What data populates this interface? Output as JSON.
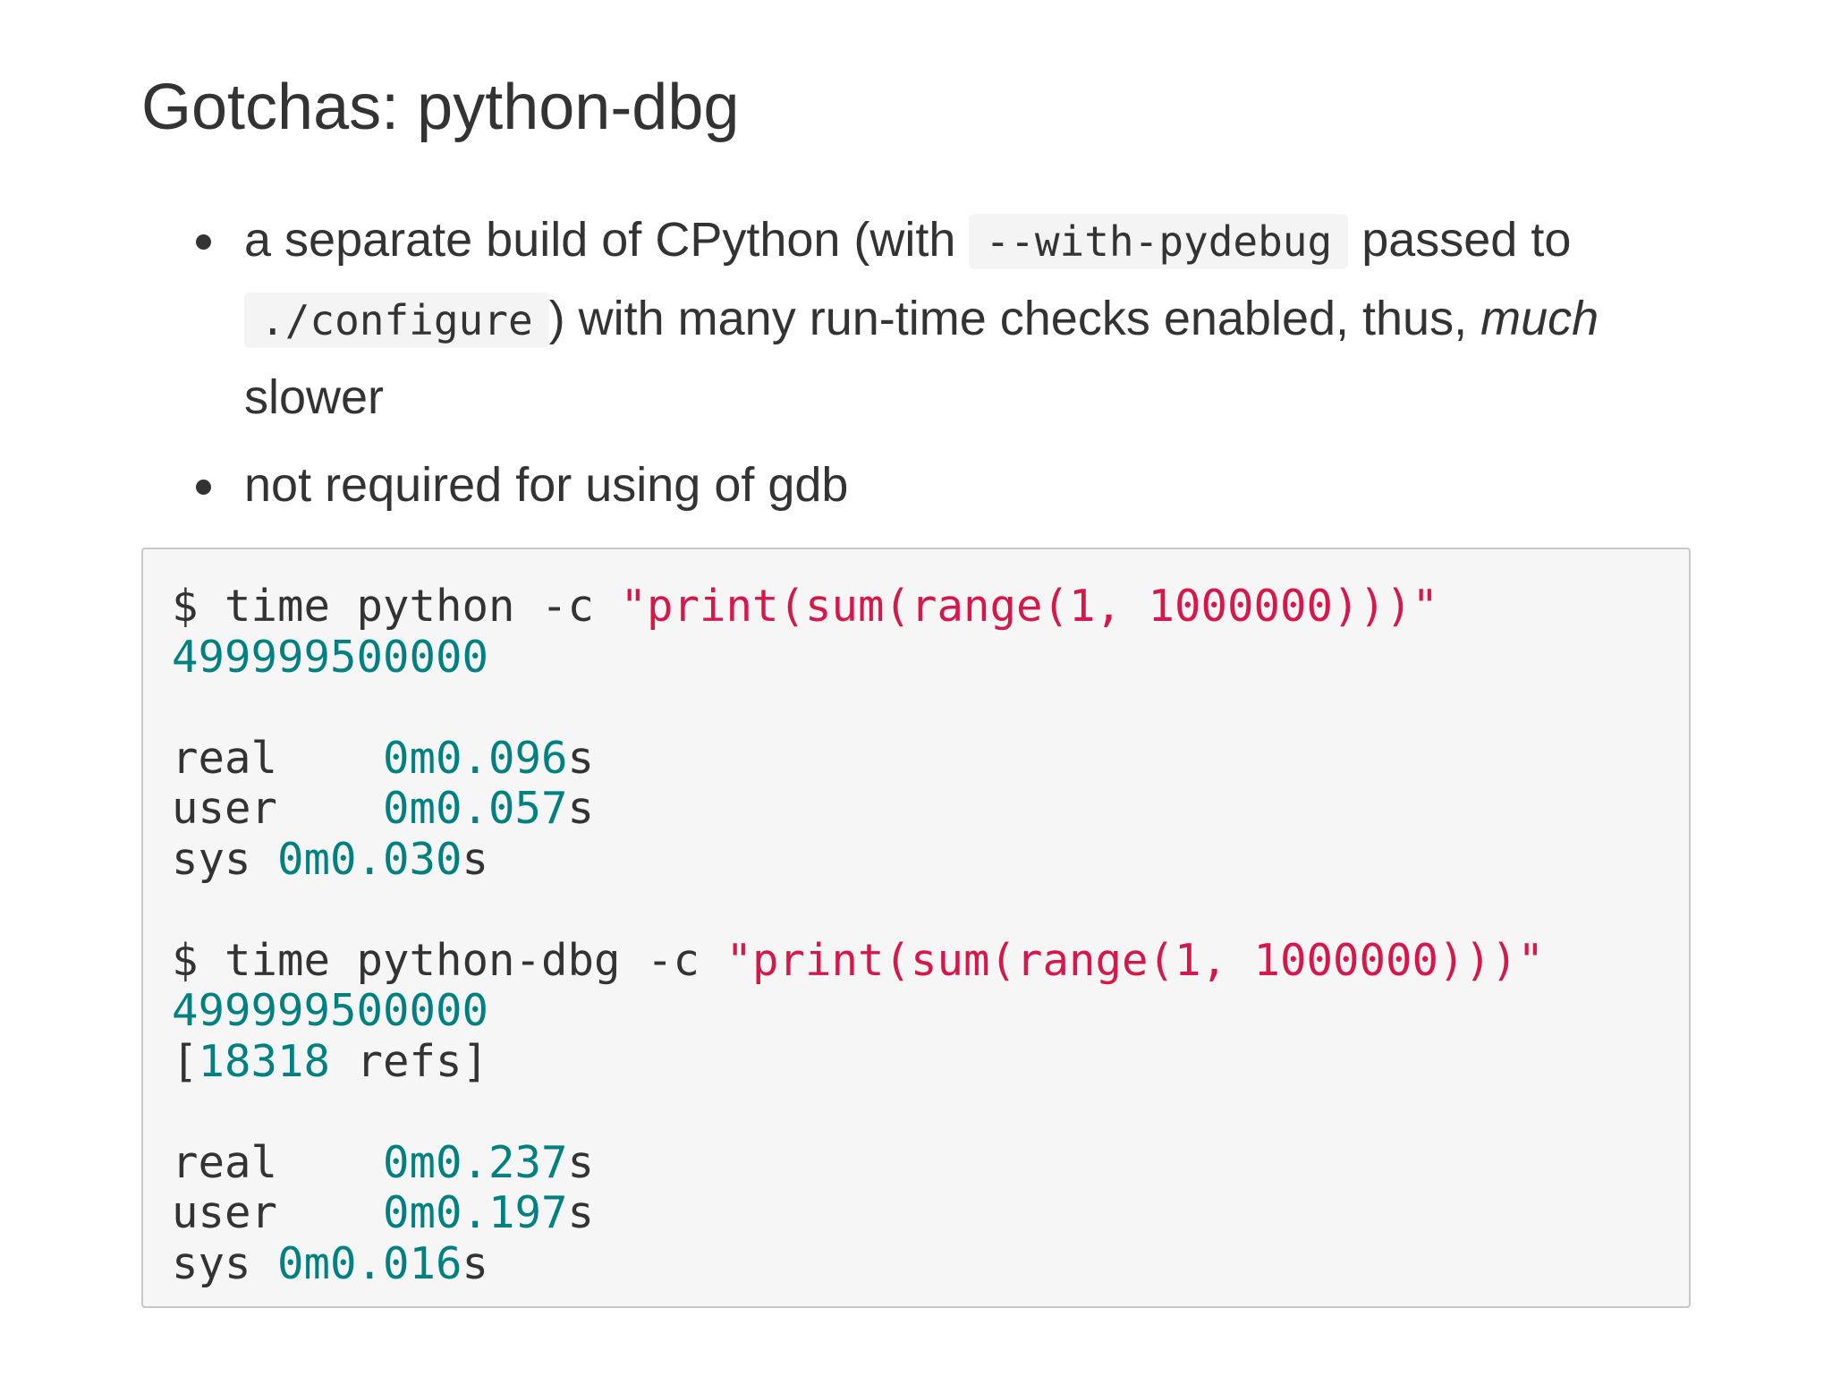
{
  "title": "Gotchas: python-dbg",
  "bullets": {
    "b1": {
      "t1": "a separate build of CPython (with ",
      "code1": "--with-pydebug",
      "t2": " passed to ",
      "code2": "./configure",
      "t3": ") with many run-time checks enabled, thus, ",
      "em": "much",
      "t4": " slower"
    },
    "b2": "not required for using of gdb"
  },
  "code": {
    "run1": {
      "prompt": "$ time python -c ",
      "arg": "\"print(sum(range(1, 1000000)))\"",
      "output": "499999500000",
      "real_label": "real    ",
      "real_val": "0m0.096",
      "user_label": "user    ",
      "user_val": "0m0.057",
      "sys_label": "sys ",
      "sys_val": "0m0.030",
      "unit": "s"
    },
    "run2": {
      "prompt": "$ time python-dbg -c ",
      "arg": "\"print(sum(range(1, 1000000)))\"",
      "output": "499999500000",
      "refs_open": "[",
      "refs_num": "18318",
      "refs_close": " refs]",
      "real_label": "real    ",
      "real_val": "0m0.237",
      "user_label": "user    ",
      "user_val": "0m0.197",
      "sys_label": "sys ",
      "sys_val": "0m0.016",
      "unit": "s"
    }
  },
  "colors": {
    "text": "#333333",
    "string": "#d6174a",
    "number": "#008080",
    "code_background": "#f6f6f7",
    "code_border": "#c8c8c8"
  }
}
